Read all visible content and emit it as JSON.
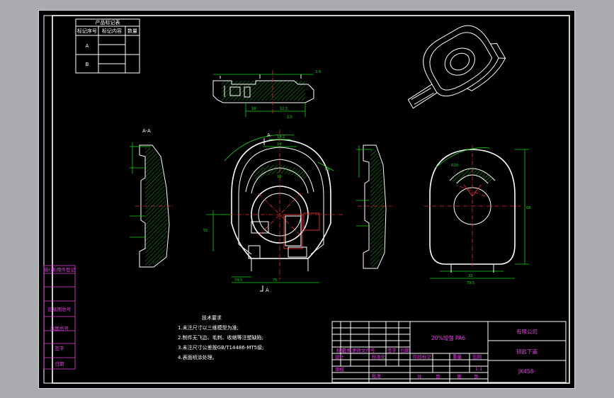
{
  "section_label": "A-A",
  "section_marks": [
    "A",
    "A"
  ],
  "revision_table": {
    "title": "产品标记表",
    "headers": [
      "标记序号",
      "标记内容",
      "数量"
    ],
    "rows": [
      "A",
      "B"
    ]
  },
  "side_panel": [
    "借(通)用件登记",
    "旧底图总号",
    "底图总号",
    "签字",
    "日期"
  ],
  "tech_req": {
    "title": "技术要求",
    "items": [
      "1.未注尺寸以三维模型为准;",
      "2.制件无飞边、毛刺、收缩等注塑缺陷;",
      "3.未注尺寸公差按GB/T14486-MT5级;",
      "4.表面喷涂处理。"
    ]
  },
  "title_block": {
    "material": "20%增强 PA6",
    "company": "有限公司",
    "part_name": "钥匙下盖",
    "drawing_no": "JK458-",
    "scale": "1:1",
    "labels": [
      "标记",
      "处数",
      "更改文件号",
      "签字",
      "日期",
      "设计",
      "审核",
      "标准化",
      "批准",
      "阶段标记",
      "重量",
      "比例",
      "共",
      "页",
      "第",
      "页"
    ]
  },
  "dims": {
    "top": [
      "18",
      "12.5",
      "1.5",
      "3.9"
    ],
    "front": [
      "14.2",
      "14",
      "10",
      "R8",
      "55",
      "75",
      "74.5"
    ],
    "right": [
      "33",
      "R20",
      "68",
      "79.5"
    ]
  },
  "colors": {
    "background": "#000000",
    "outline": "#ffffff",
    "dimension": "#19d019",
    "centerline": "#e23030",
    "title_block": "#e040e0"
  }
}
